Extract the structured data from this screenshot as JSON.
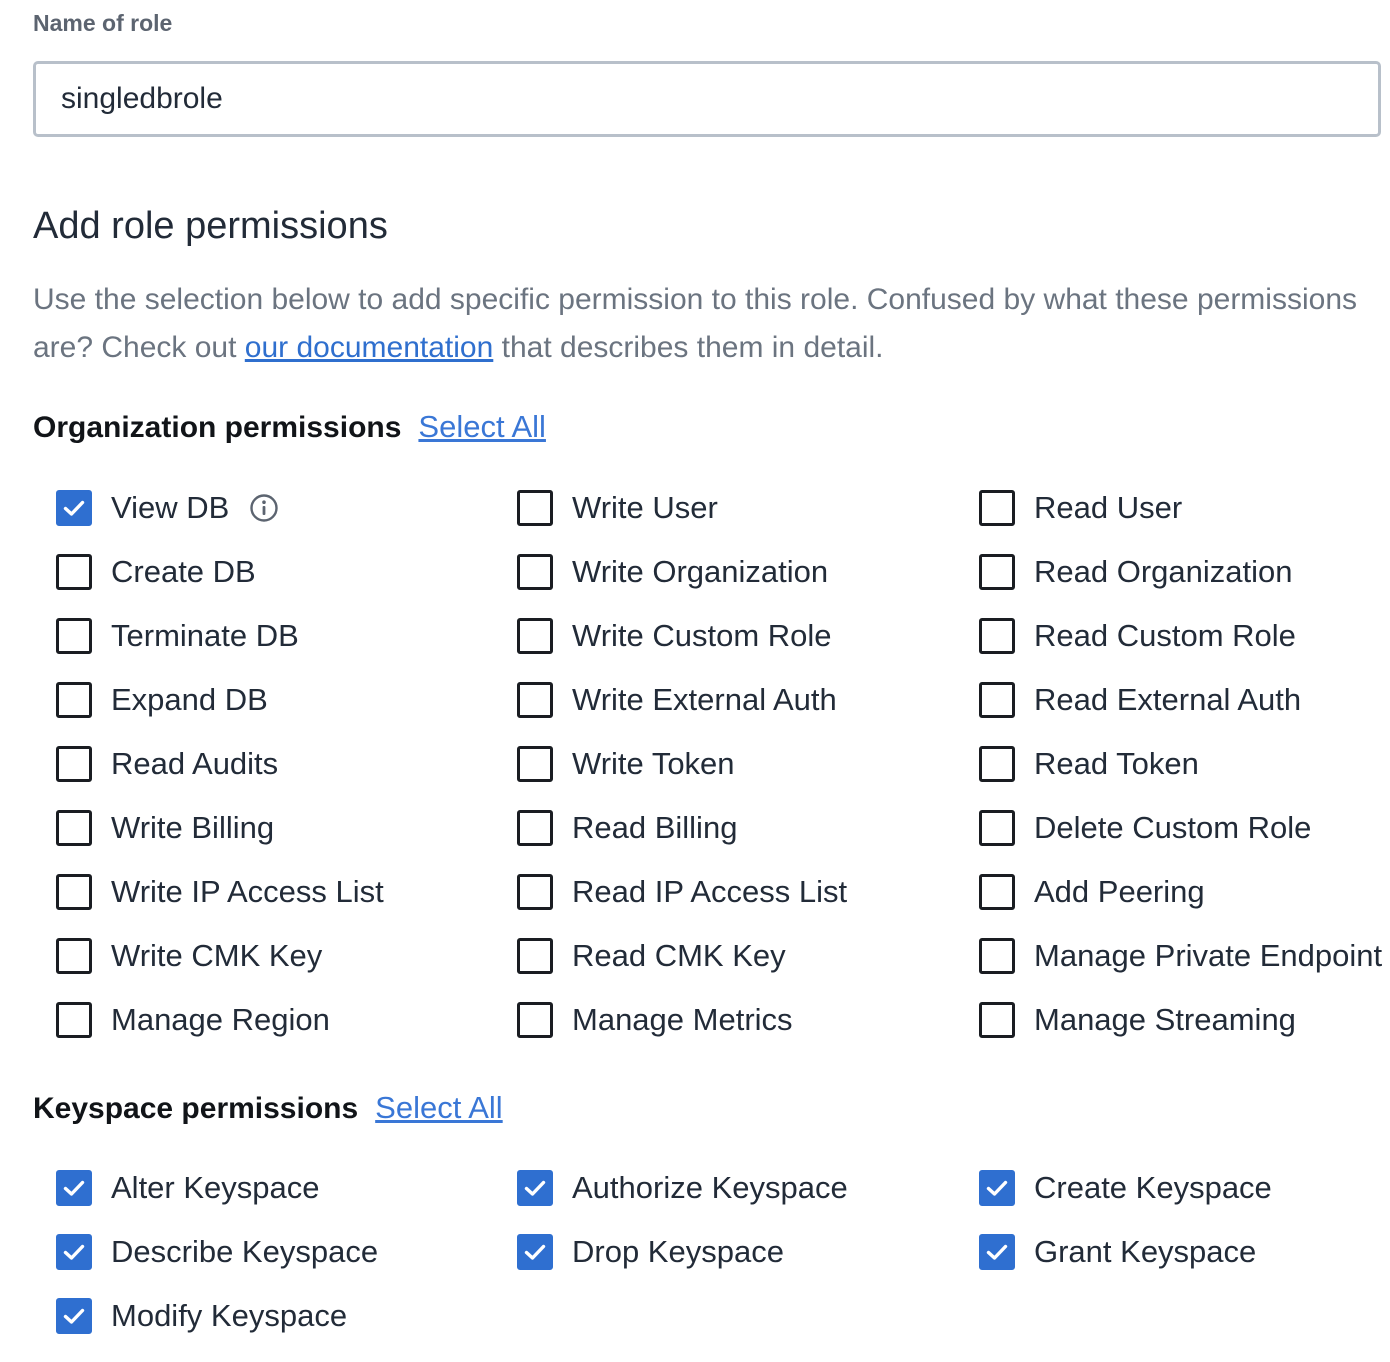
{
  "role_name": {
    "label": "Name of role",
    "value": "singledbrole"
  },
  "permissions_section": {
    "title": "Add role permissions",
    "description_before": "Use the selection below to add specific permission to this role. Confused by what these permissions are? Check out ",
    "doc_link": "our documentation",
    "description_after": " that describes them in detail."
  },
  "organization": {
    "title": "Organization permissions",
    "select_all": "Select All",
    "items": [
      {
        "label": "View DB",
        "checked": true,
        "info": true
      },
      {
        "label": "Write User",
        "checked": false
      },
      {
        "label": "Read User",
        "checked": false
      },
      {
        "label": "Create DB",
        "checked": false
      },
      {
        "label": "Write Organization",
        "checked": false
      },
      {
        "label": "Read Organization",
        "checked": false
      },
      {
        "label": "Terminate DB",
        "checked": false
      },
      {
        "label": "Write Custom Role",
        "checked": false
      },
      {
        "label": "Read Custom Role",
        "checked": false
      },
      {
        "label": "Expand DB",
        "checked": false
      },
      {
        "label": "Write External Auth",
        "checked": false
      },
      {
        "label": "Read External Auth",
        "checked": false
      },
      {
        "label": "Read Audits",
        "checked": false
      },
      {
        "label": "Write Token",
        "checked": false
      },
      {
        "label": "Read Token",
        "checked": false
      },
      {
        "label": "Write Billing",
        "checked": false
      },
      {
        "label": "Read Billing",
        "checked": false
      },
      {
        "label": "Delete Custom Role",
        "checked": false
      },
      {
        "label": "Write IP Access List",
        "checked": false
      },
      {
        "label": "Read IP Access List",
        "checked": false
      },
      {
        "label": "Add Peering",
        "checked": false
      },
      {
        "label": "Write CMK Key",
        "checked": false
      },
      {
        "label": "Read CMK Key",
        "checked": false
      },
      {
        "label": "Manage Private Endpoint",
        "checked": false
      },
      {
        "label": "Manage Region",
        "checked": false
      },
      {
        "label": "Manage Metrics",
        "checked": false
      },
      {
        "label": "Manage Streaming",
        "checked": false
      }
    ]
  },
  "keyspace": {
    "title": "Keyspace permissions",
    "select_all": "Select All",
    "items": [
      {
        "label": "Alter Keyspace",
        "checked": true
      },
      {
        "label": "Authorize Keyspace",
        "checked": true
      },
      {
        "label": "Create Keyspace",
        "checked": true
      },
      {
        "label": "Describe Keyspace",
        "checked": true
      },
      {
        "label": "Drop Keyspace",
        "checked": true
      },
      {
        "label": "Grant Keyspace",
        "checked": true
      },
      {
        "label": "Modify Keyspace",
        "checked": true
      }
    ]
  },
  "colors": {
    "accent": "#2f6fd0",
    "link": "#3a77d6"
  },
  "icons": {
    "check": "checkmark-icon",
    "info": "info-circle-icon"
  }
}
